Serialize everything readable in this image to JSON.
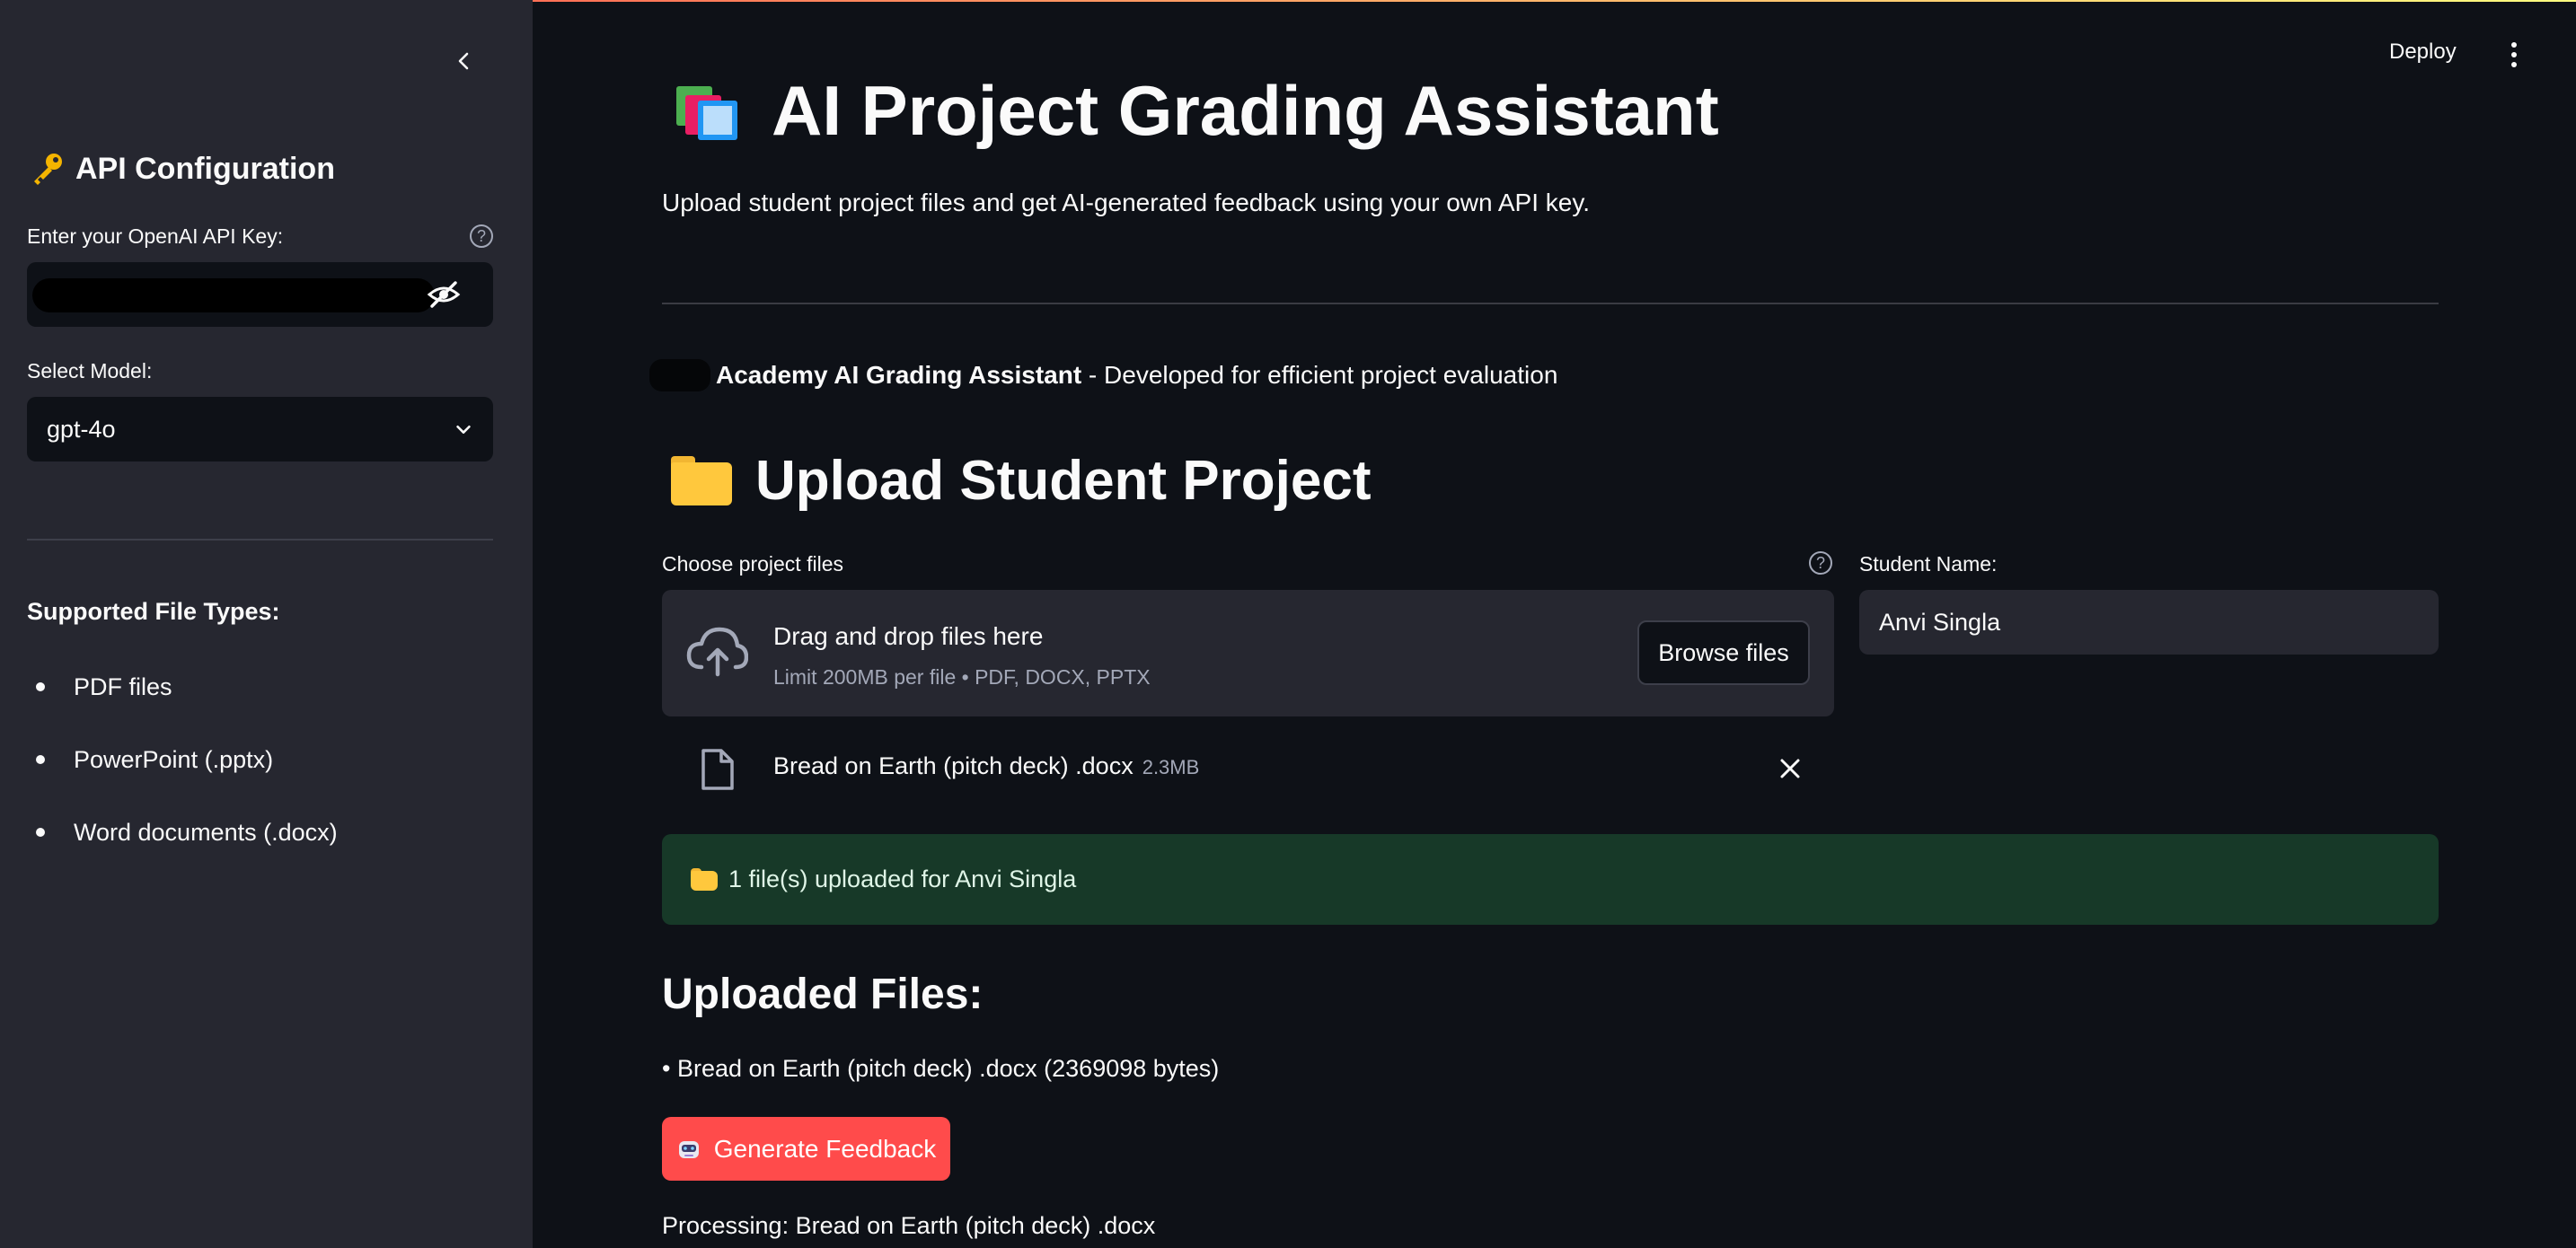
{
  "header": {
    "deploy_label": "Deploy"
  },
  "sidebar": {
    "title": "API Configuration",
    "api_key_label": "Enter your OpenAI API Key:",
    "model_label": "Select Model:",
    "model_value": "gpt-4o",
    "supported_title": "Supported File Types:",
    "file_types": [
      "PDF files",
      "PowerPoint (.pptx)",
      "Word documents (.docx)"
    ]
  },
  "main": {
    "title": "AI Project Grading Assistant",
    "subtitle": "Upload student project files and get AI-generated feedback using your own API key.",
    "credit_bold": "Academy AI Grading Assistant",
    "credit_rest": " - Developed for efficient project evaluation",
    "upload_heading": "Upload Student Project",
    "choose_label": "Choose project files",
    "dropzone_title": "Drag and drop files here",
    "dropzone_limit": "Limit 200MB per file • PDF, DOCX, PPTX",
    "browse_label": "Browse files",
    "student_label": "Student Name:",
    "student_value": "Anvi Singla",
    "file_name": "Bread on Earth (pitch deck) .docx",
    "file_size": "2.3MB",
    "success_message": "1 file(s) uploaded for Anvi Singla",
    "uploaded_heading": "Uploaded Files:",
    "uploaded_item": "• Bread on Earth (pitch deck) .docx (2369098 bytes)",
    "generate_label": "Generate Feedback",
    "processing_text": "Processing: Bread on Earth (pitch deck) .docx"
  },
  "colors": {
    "background": "#0e1117",
    "sidebar": "#262730",
    "primary": "#ff4b4b",
    "success_bg": "#173928"
  },
  "icons": [
    "key-icon",
    "books-icon",
    "folder-icon",
    "cloud-upload-icon",
    "file-icon",
    "close-icon",
    "robot-icon",
    "eye-off-icon",
    "chevron-down-icon",
    "chevron-left-icon",
    "help-icon"
  ]
}
